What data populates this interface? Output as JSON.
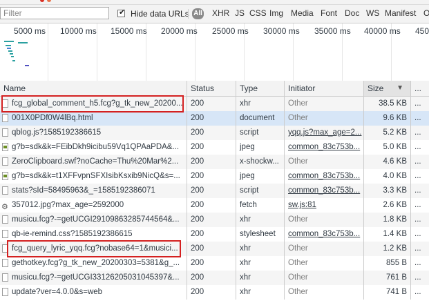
{
  "filter": {
    "placeholder": "Filter"
  },
  "hide_data_urls": {
    "label": "Hide data URLs",
    "checked": true
  },
  "type_filters": [
    {
      "label": "All"
    },
    {
      "label": "XHR"
    },
    {
      "label": "JS"
    },
    {
      "label": "CSS"
    },
    {
      "label": "Img"
    },
    {
      "label": "Media"
    },
    {
      "label": "Font"
    },
    {
      "label": "Doc"
    },
    {
      "label": "WS"
    },
    {
      "label": "Manifest"
    },
    {
      "label": "O"
    }
  ],
  "timeline": {
    "ticks": [
      "5000 ms",
      "10000 ms",
      "15000 ms",
      "20000 ms",
      "25000 ms",
      "30000 ms",
      "35000 ms",
      "40000 ms",
      "450"
    ]
  },
  "columns": {
    "name": "Name",
    "status": "Status",
    "type": "Type",
    "initiator": "Initiator",
    "size": "Size",
    "time": "..."
  },
  "rows": [
    {
      "name": "fcg_global_comment_h5.fcg?g_tk_new_20200...",
      "status": "200",
      "type": "xhr",
      "initiator": "Other",
      "initiator_link": false,
      "size": "38.5 KB",
      "time": "...",
      "icon": "file"
    },
    {
      "name": "001X0PDf0W4lBq.html",
      "status": "200",
      "type": "document",
      "initiator": "Other",
      "initiator_link": false,
      "size": "9.6 KB",
      "time": "...",
      "icon": "file"
    },
    {
      "name": "qblog.js?1585192386615",
      "status": "200",
      "type": "script",
      "initiator": "yqq.js?max_age=2...",
      "initiator_link": true,
      "size": "5.2 KB",
      "time": "...",
      "icon": "file"
    },
    {
      "name": "g?b=sdk&k=FEibDkh9icibu59Vq1QPAaPDA&...",
      "status": "200",
      "type": "jpeg",
      "initiator": "common_83c753b...",
      "initiator_link": true,
      "size": "5.0 KB",
      "time": "...",
      "icon": "img"
    },
    {
      "name": "ZeroClipboard.swf?noCache=Thu%20Mar%2...",
      "status": "200",
      "type": "x-shockw...",
      "initiator": "Other",
      "initiator_link": false,
      "size": "4.6 KB",
      "time": "...",
      "icon": "file"
    },
    {
      "name": "g?b=sdk&k=t1XFFvpnSFXIsibKsxib9NicQ&s=...",
      "status": "200",
      "type": "jpeg",
      "initiator": "common_83c753b...",
      "initiator_link": true,
      "size": "4.0 KB",
      "time": "...",
      "icon": "img"
    },
    {
      "name": "stats?sId=58495963&_=1585192386071",
      "status": "200",
      "type": "script",
      "initiator": "common_83c753b...",
      "initiator_link": true,
      "size": "3.3 KB",
      "time": "...",
      "icon": "file"
    },
    {
      "name": "357012.jpg?max_age=2592000",
      "status": "200",
      "type": "fetch",
      "initiator": "sw.js:81",
      "initiator_link": true,
      "size": "2.6 KB",
      "time": "...",
      "icon": "gear"
    },
    {
      "name": "musicu.fcg?-=getUCGI29109863285744564&...",
      "status": "200",
      "type": "xhr",
      "initiator": "Other",
      "initiator_link": false,
      "size": "1.8 KB",
      "time": "...",
      "icon": "file"
    },
    {
      "name": "qb-ie-remind.css?1585192386615",
      "status": "200",
      "type": "stylesheet",
      "initiator": "common_83c753b...",
      "initiator_link": true,
      "size": "1.4 KB",
      "time": "...",
      "icon": "file"
    },
    {
      "name": "fcg_query_lyric_yqq.fcg?nobase64=1&musici...",
      "status": "200",
      "type": "xhr",
      "initiator": "Other",
      "initiator_link": false,
      "size": "1.2 KB",
      "time": "...",
      "icon": "file"
    },
    {
      "name": "gethotkey.fcg?g_tk_new_20200303=5381&g_...",
      "status": "200",
      "type": "xhr",
      "initiator": "Other",
      "initiator_link": false,
      "size": "855 B",
      "time": "...",
      "icon": "file"
    },
    {
      "name": "musicu.fcg?-=getUCGI33126205031045397&...",
      "status": "200",
      "type": "xhr",
      "initiator": "Other",
      "initiator_link": false,
      "size": "761 B",
      "time": "...",
      "icon": "file"
    },
    {
      "name": "update?ver=4.0.0&s=web",
      "status": "200",
      "type": "xhr",
      "initiator": "Other",
      "initiator_link": false,
      "size": "741 B",
      "time": "...",
      "icon": "file"
    }
  ]
}
